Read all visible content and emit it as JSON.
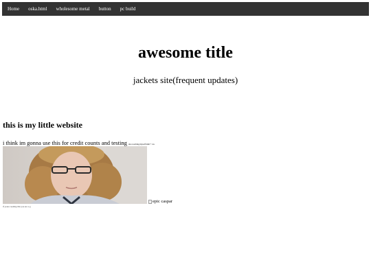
{
  "nav": {
    "items": [
      {
        "label": "Home"
      },
      {
        "label": "oska.html"
      },
      {
        "label": "wholesome metal"
      },
      {
        "label": "button"
      },
      {
        "label": "pc build"
      }
    ]
  },
  "header": {
    "title": "awesome title",
    "subtitle": "jackets site(frequent updates)"
  },
  "main": {
    "heading": "this is my little website",
    "paragraph": "i think im gonna use this for credit counts and testing",
    "small_note": "also teaching myself html + css",
    "image_alt": "epic caspar",
    "footer_note": "if youre reading this you are a g"
  },
  "colors": {
    "navbar": "#333333",
    "nav_text": "#ffffff"
  }
}
